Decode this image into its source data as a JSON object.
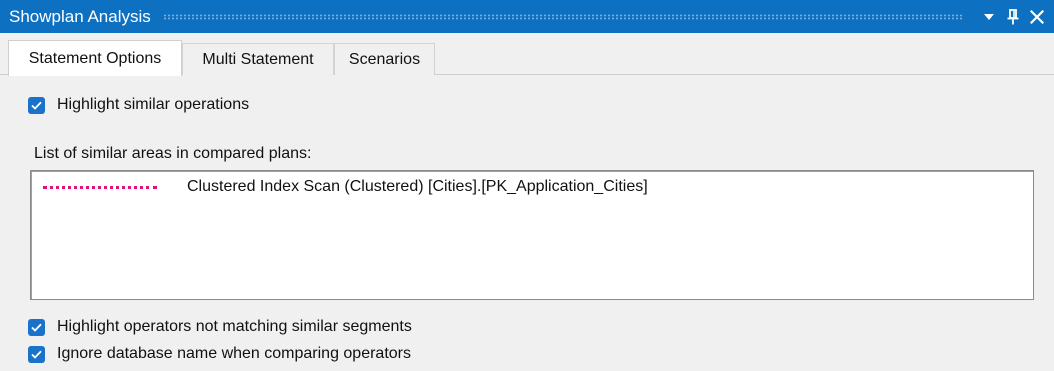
{
  "titlebar": {
    "title": "Showplan Analysis",
    "buttons": [
      {
        "name": "dropdown",
        "icon": "chevron-down-icon"
      },
      {
        "name": "pin",
        "icon": "pin-icon"
      },
      {
        "name": "close",
        "icon": "close-icon"
      }
    ]
  },
  "tabs": [
    {
      "label": "Statement Options",
      "active": true
    },
    {
      "label": "Multi Statement",
      "active": false
    },
    {
      "label": "Scenarios",
      "active": false
    }
  ],
  "options": {
    "highlight_similar": {
      "label": "Highlight similar operations",
      "checked": true
    },
    "highlight_not_matching": {
      "label": "Highlight operators not matching similar segments",
      "checked": true
    },
    "ignore_db_name": {
      "label": "Ignore database name when comparing operators",
      "checked": true
    }
  },
  "similar_areas": {
    "caption": "List of similar areas in compared plans:",
    "items": [
      {
        "line_color": "#e0117a",
        "text": "Clustered Index Scan (Clustered) [Cities].[PK_Application_Cities]"
      }
    ]
  },
  "colors": {
    "titlebar": "#0e70c0",
    "checkbox": "#1a73c9",
    "background": "#f0f0f0"
  }
}
